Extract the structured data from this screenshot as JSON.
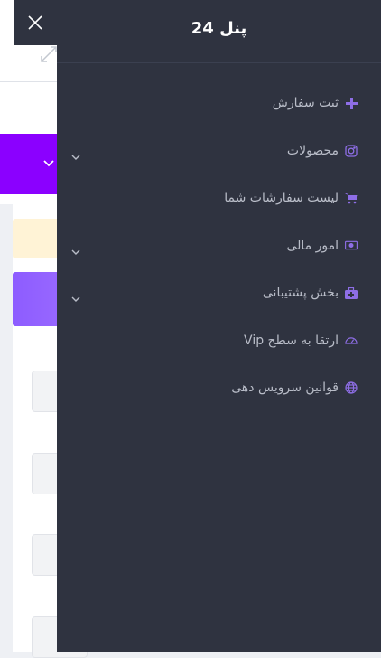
{
  "colors": {
    "drawer_bg": "#2f3340",
    "menu_text": "#b9bdc8",
    "icon_accent": "#8e6ee6",
    "hero_purple": "#8b00ff",
    "alert_bg": "#fff3d6"
  },
  "drawer": {
    "title": "پنل 24",
    "close_icon": "close-icon"
  },
  "menu": {
    "items": [
      {
        "label": "ثبت سفارش",
        "icon": "plus-icon",
        "has_submenu": false
      },
      {
        "label": "محصولات",
        "icon": "instagram-icon",
        "has_submenu": true
      },
      {
        "label": "لیست سفارشات شما",
        "icon": "cart-icon",
        "has_submenu": false
      },
      {
        "label": "امور مالی",
        "icon": "money-icon",
        "has_submenu": true
      },
      {
        "label": "بخش پشتیبانی",
        "icon": "medkit-icon",
        "has_submenu": true
      },
      {
        "label": "ارتقا به سطح Vip",
        "icon": "gauge-icon",
        "has_submenu": false
      },
      {
        "label": "قوانین سرویس دهی",
        "icon": "globe-icon",
        "has_submenu": false
      }
    ]
  }
}
